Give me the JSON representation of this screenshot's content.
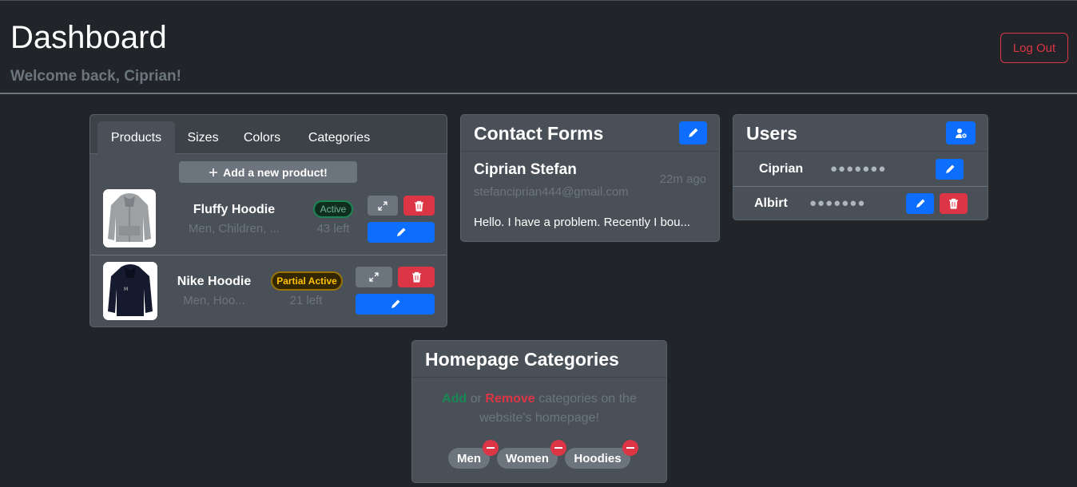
{
  "header": {
    "title": "Dashboard",
    "welcome": "Welcome back, Ciprian!",
    "logout_label": "Log Out"
  },
  "products_card": {
    "tabs": [
      {
        "label": "Products",
        "active": true
      },
      {
        "label": "Sizes",
        "active": false
      },
      {
        "label": "Colors",
        "active": false
      },
      {
        "label": "Categories",
        "active": false
      }
    ],
    "add_label": "Add a new product!",
    "items": [
      {
        "name": "Fluffy Hoodie",
        "categories": "Men, Children, ...",
        "status": "Active",
        "stock": "43 left",
        "image": "gray-hoodie"
      },
      {
        "name": "Nike Hoodie",
        "categories": "Men, Hoo...",
        "status": "Partial Active",
        "stock": "21 left",
        "image": "black-hoodie"
      }
    ]
  },
  "contact_forms": {
    "title": "Contact Forms",
    "entries": [
      {
        "name": "Ciprian Stefan",
        "email": "stefanciprian444@gmail.com",
        "time": "22m ago",
        "message": "Hello. I have a problem. Recently I bou..."
      }
    ]
  },
  "users": {
    "title": "Users",
    "list": [
      {
        "name": "Ciprian",
        "password_mask": "●●●●●●●",
        "deletable": false
      },
      {
        "name": "Albirt",
        "password_mask": "●●●●●●●",
        "deletable": true
      }
    ]
  },
  "homepage_categories": {
    "title": "Homepage Categories",
    "add_word": "Add",
    "or_word": " or ",
    "remove_word": "Remove",
    "rest_text": " categories on the website's homepage!",
    "chips": [
      "Men",
      "Women",
      "Hoodies"
    ]
  },
  "colors": {
    "background": "#212529",
    "card": "#495057",
    "primary": "#0d6efd",
    "danger": "#dc3545",
    "success": "#198754",
    "warning": "#ffc107",
    "muted": "#6c757d"
  },
  "icons": [
    "pencil-icon",
    "trash-icon",
    "expand-icon",
    "plus-icon",
    "user-plus-icon",
    "minus-circle-icon"
  ]
}
